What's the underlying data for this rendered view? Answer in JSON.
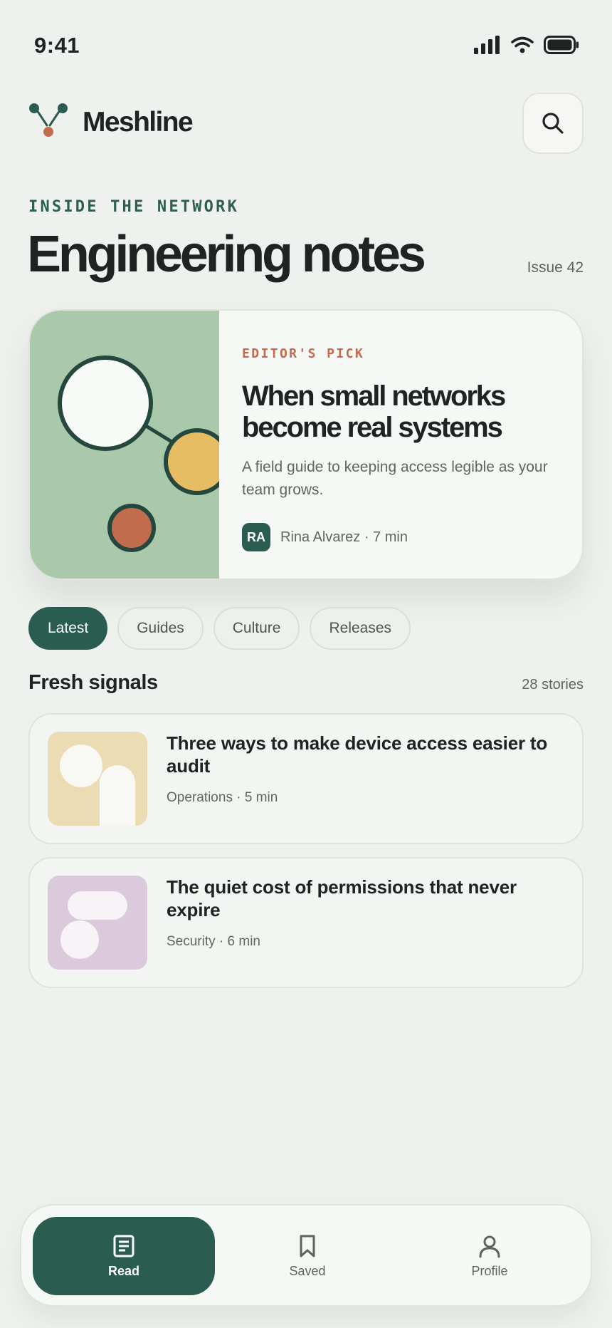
{
  "status_bar": {
    "time": "9:41"
  },
  "header": {
    "brand": "Meshline"
  },
  "hero": {
    "eyebrow": "INSIDE THE NETWORK",
    "title": "Engineering notes",
    "issue": "Issue 42"
  },
  "featured": {
    "label": "EDITOR'S PICK",
    "title": "When small networks become real systems",
    "description": "A field guide to keeping access legible as your team grows.",
    "author_initials": "RA",
    "byline": "Rina Alvarez · 7 min"
  },
  "filters": {
    "chips": [
      "Latest",
      "Guides",
      "Culture",
      "Releases"
    ],
    "selected": "Latest"
  },
  "section": {
    "title": "Fresh signals",
    "count": "28 stories"
  },
  "stories": [
    {
      "title": "Three ways to make device access easier to audit",
      "meta": "Operations · 5 min",
      "thumb_color": "#ecdcb4"
    },
    {
      "title": "The quiet cost of permissions that never expire",
      "meta": "Security · 6 min",
      "thumb_color": "#dbc9dc"
    }
  ],
  "bottom_nav": {
    "items": [
      {
        "label": "Read",
        "icon": "document-icon"
      },
      {
        "label": "Saved",
        "icon": "bookmark-icon"
      },
      {
        "label": "Profile",
        "icon": "person-icon"
      }
    ],
    "active": "Read"
  },
  "colors": {
    "background": "#eff1ee",
    "accent": "#2a5d50",
    "terracotta": "#c26c4e",
    "art_green": "#a9c9aa",
    "art_yellow": "#e6bd63"
  }
}
